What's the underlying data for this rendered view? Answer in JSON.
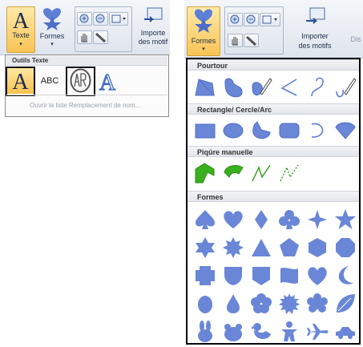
{
  "colors": {
    "shape_fill": "#6a86d6",
    "shape_stroke": "#5270c4",
    "accent_yellow": "#f8c455",
    "green": "#3bb01e"
  },
  "left_ribbon": {
    "texte_label": "Texte",
    "formes_label": "Formes",
    "importer_label": "Importe",
    "des_motifs_label": "des motif"
  },
  "text_popup": {
    "header": "Outils Texte",
    "abc_label": "ABC",
    "footer": "Ouvrir la liste Remplacement de nom..."
  },
  "right_ribbon": {
    "formes_label": "Formes",
    "importer_label": "Importer",
    "des_motifs_label": "des motifs",
    "dis_label": "Dis"
  },
  "shapes_panel": {
    "cat_pourtour": "Pourtour",
    "cat_rect": "Rectangle/ Cercle/Arc",
    "cat_piqure": "Piqûre manuelle",
    "cat_formes": "Formes"
  }
}
